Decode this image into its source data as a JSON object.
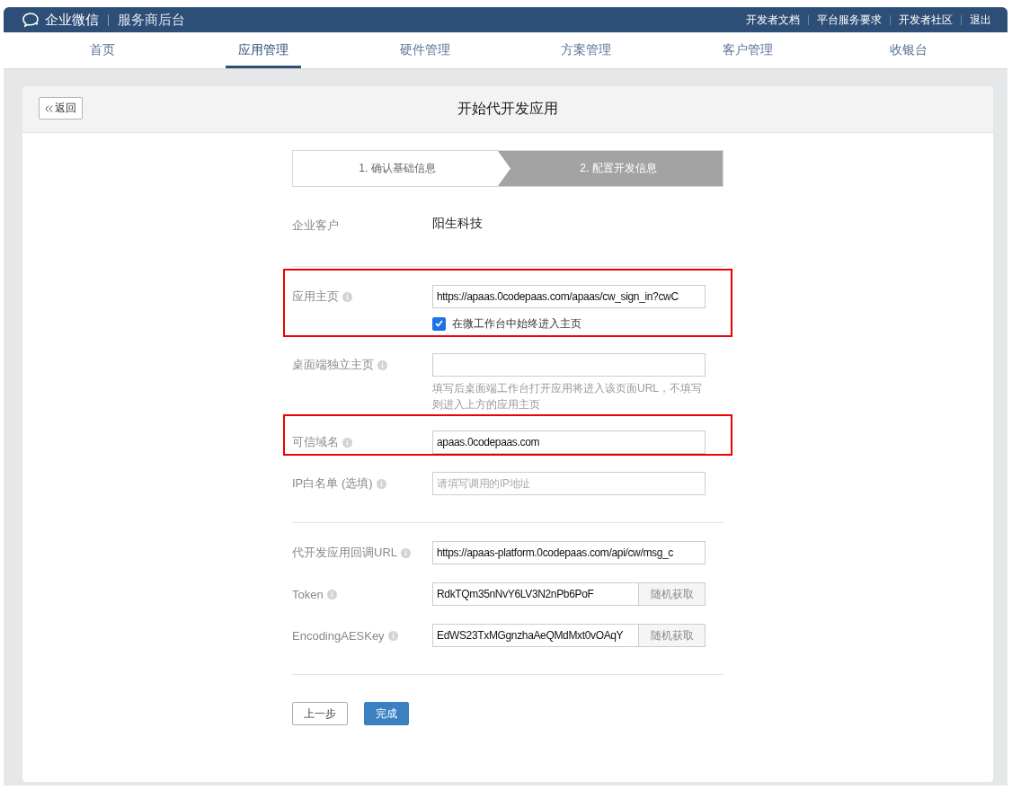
{
  "header": {
    "brand": "企业微信",
    "subtitle": "服务商后台",
    "links": [
      "开发者文档",
      "平台服务要求",
      "开发者社区",
      "退出"
    ]
  },
  "nav": [
    {
      "label": "首页",
      "selected": false
    },
    {
      "label": "应用管理",
      "selected": true
    },
    {
      "label": "硬件管理",
      "selected": false
    },
    {
      "label": "方案管理",
      "selected": false
    },
    {
      "label": "客户管理",
      "selected": false
    },
    {
      "label": "收银台",
      "selected": false
    }
  ],
  "card": {
    "back": "返回",
    "title": "开始代开发应用"
  },
  "steps": [
    {
      "label": "1. 确认基础信息",
      "selected": false
    },
    {
      "label": "2. 配置开发信息",
      "selected": true
    }
  ],
  "customer": {
    "label": "企业客户",
    "value": "阳生科技"
  },
  "sections": [
    [
      {
        "label": "应用主页",
        "value": "https://apaas.0codepaas.com/apaas/cw_sign_in?cwC",
        "highlighted": true,
        "checkbox": {
          "label": "在微工作台中始终进入主页",
          "checked": true
        }
      },
      {
        "label": "桌面端独立主页",
        "highlighted": false,
        "hint": "填写后桌面端工作台打开应用将进入该页面URL，不填写则进入上方的应用主页"
      },
      {
        "label": "可信域名",
        "value": "apaas.0codepaas.com",
        "highlighted": true
      },
      {
        "label": "IP白名单 (选填)",
        "placeholder": "请填写调用的IP地址",
        "highlighted": false
      }
    ],
    [
      {
        "label": "代开发应用回调URL",
        "value": "https://apaas-platform.0codepaas.com/api/cw/msg_c",
        "highlighted": false
      },
      {
        "label": "Token",
        "value": "RdkTQm35nNvY6LV3N2nPb6PoF",
        "highlighted": false,
        "button": "随机获取"
      },
      {
        "label": "EncodingAESKey",
        "value": "EdWS23TxMGgnzhaAeQMdMxt0vOAqY",
        "highlighted": false,
        "button": "随机获取"
      }
    ]
  ],
  "actions": [
    {
      "label": "上一步",
      "kind": "secondary"
    },
    {
      "label": "完成",
      "kind": "primary"
    }
  ]
}
